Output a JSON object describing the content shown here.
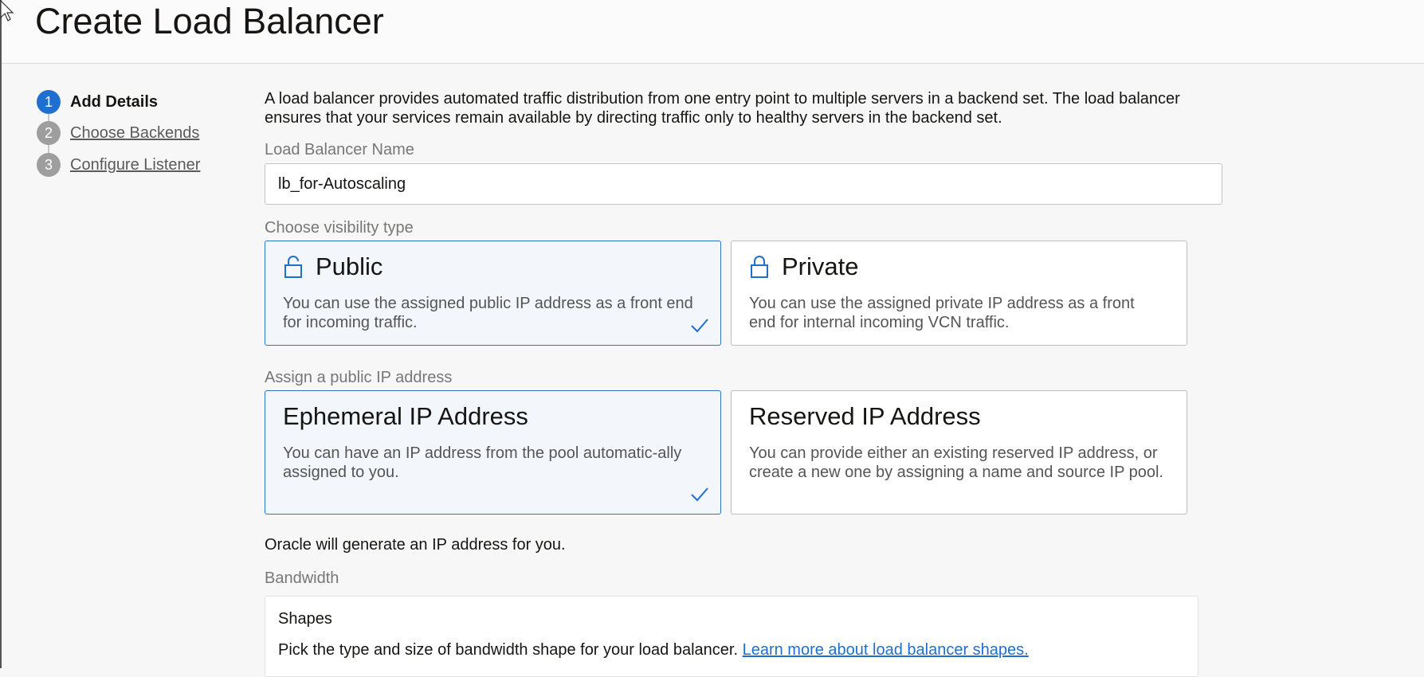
{
  "page": {
    "title": "Create Load Balancer"
  },
  "steps": [
    {
      "number": "1",
      "label": "Add Details"
    },
    {
      "number": "2",
      "label": "Choose Backends"
    },
    {
      "number": "3",
      "label": "Configure Listener"
    }
  ],
  "intro": "A load balancer provides automated traffic distribution from one entry point to multiple servers in a backend set. The load balancer ensures that your services remain available by directing traffic only to healthy servers in the backend set.",
  "name_field": {
    "label": "Load Balancer Name",
    "value": "lb_for-Autoscaling"
  },
  "visibility": {
    "label": "Choose visibility type",
    "options": [
      {
        "title": "Public",
        "description": "You can use the assigned public IP address as a front end for incoming traffic.",
        "selected": true,
        "icon": "unlock-icon"
      },
      {
        "title": "Private",
        "description": "You can use the assigned private IP address as a front end for internal incoming VCN traffic.",
        "selected": false,
        "icon": "lock-icon"
      }
    ]
  },
  "public_ip": {
    "label": "Assign a public IP address",
    "options": [
      {
        "title": "Ephemeral IP Address",
        "description": "You can have an IP address from the pool automatic-ally assigned to you.",
        "selected": true
      },
      {
        "title": "Reserved IP Address",
        "description": "You can provide either an existing reserved IP address, or create a new one by assigning a name and source IP pool.",
        "selected": false
      }
    ],
    "note": "Oracle will generate an IP address for you."
  },
  "bandwidth": {
    "label": "Bandwidth",
    "shapes_title": "Shapes",
    "shapes_desc": "Pick the type and size of bandwidth shape for your load balancer.",
    "shapes_link": "Learn more about load balancer shapes."
  },
  "colors": {
    "accent": "#1e6fd0",
    "selected_border": "#2a74c4",
    "selected_bg": "#f3f7fb"
  }
}
